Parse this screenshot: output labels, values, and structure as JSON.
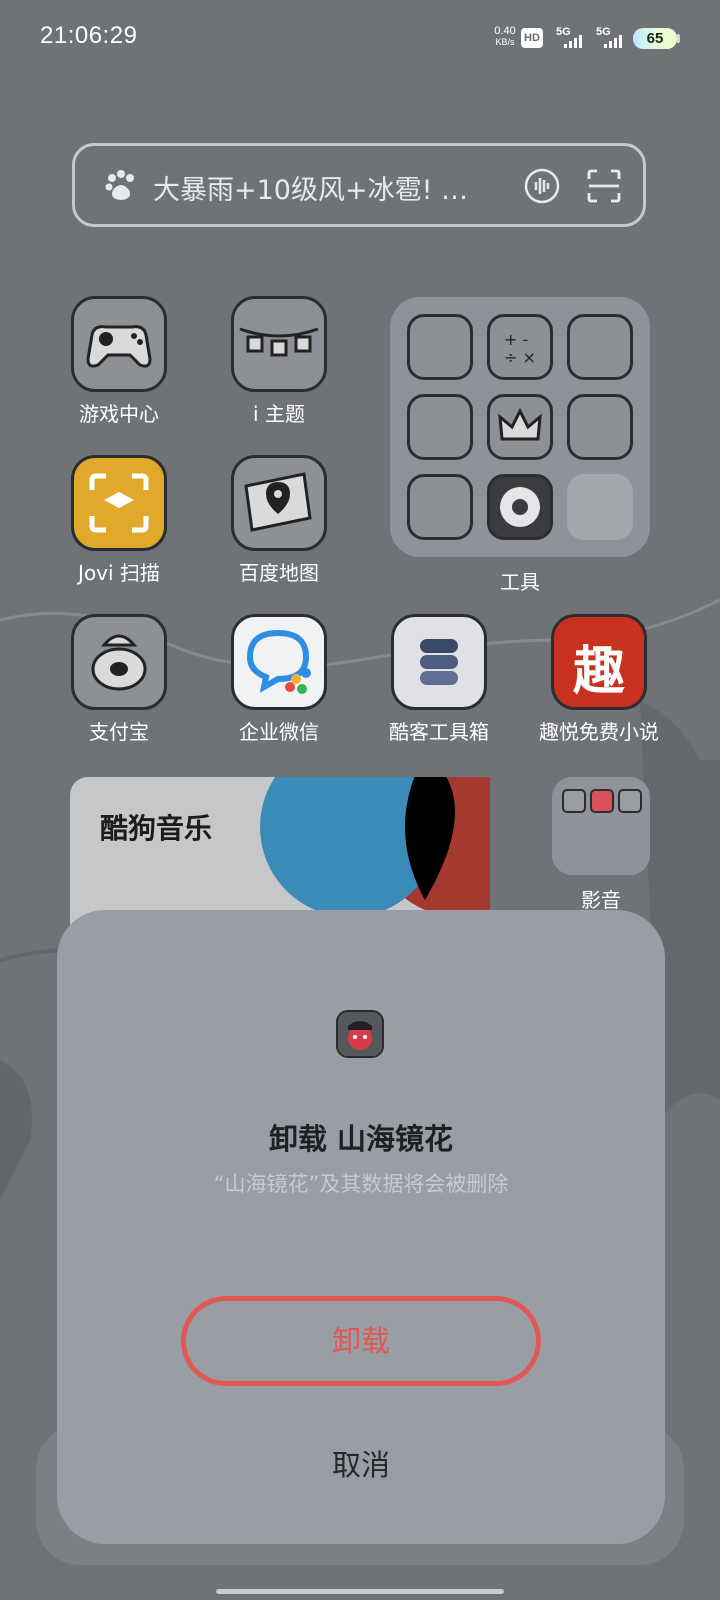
{
  "status_bar": {
    "time": "21:06:29",
    "net_speed_value": "0.40",
    "net_speed_unit": "KB/s",
    "hd_label": "HD",
    "sim1_label": "5G",
    "sim2_label": "5G",
    "battery_level": "65"
  },
  "search": {
    "query": "大暴雨+10级风+冰雹! …",
    "icons": [
      "baidu-paw-icon",
      "voice-icon",
      "scan-icon"
    ]
  },
  "apps": {
    "row1": [
      {
        "label": "游戏中心",
        "icon": "gamepad-icon"
      },
      {
        "label": "i 主题",
        "icon": "theme-icon"
      }
    ],
    "row2": [
      {
        "label": "Jovi 扫描",
        "icon": "jovi-scan-icon"
      },
      {
        "label": "百度地图",
        "icon": "map-icon"
      }
    ],
    "row3": [
      {
        "label": "支付宝",
        "icon": "alipay-icon"
      },
      {
        "label": "企业微信",
        "icon": "wecom-icon"
      },
      {
        "label": "酷客工具箱",
        "icon": "toolbox-icon"
      },
      {
        "label": "趣悦免费小说",
        "icon": "novel-icon"
      }
    ],
    "novel_glyph": "趣"
  },
  "tools_folder": {
    "label": "工具"
  },
  "kugou_widget": {
    "title": "酷狗音乐"
  },
  "media_folder": {
    "label": "影音"
  },
  "dialog": {
    "title": "卸载 山海镜花",
    "subtitle": "“山海镜花”及其数据将会被删除",
    "uninstall_label": "卸载",
    "cancel_label": "取消"
  },
  "colors": {
    "accent_danger": "#e25755",
    "dialog_bg": "#999ea4",
    "page_bg": "#6f7378"
  }
}
